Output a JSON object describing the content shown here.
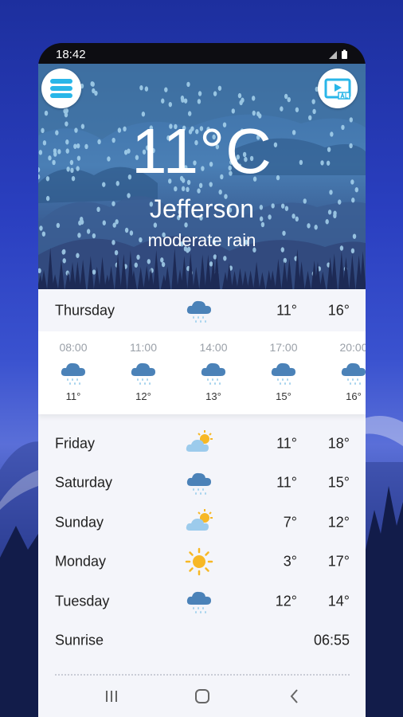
{
  "status_bar": {
    "time": "18:42"
  },
  "current": {
    "temperature": "11°C",
    "city": "Jefferson",
    "condition": "moderate rain"
  },
  "today": {
    "day": "Thursday",
    "icon": "rain-cloud-icon",
    "low": "11°",
    "high": "16°",
    "hourly": [
      {
        "time": "08:00",
        "icon": "rain-cloud-icon",
        "temp": "11°"
      },
      {
        "time": "11:00",
        "icon": "rain-cloud-icon",
        "temp": "12°"
      },
      {
        "time": "14:00",
        "icon": "rain-cloud-icon",
        "temp": "13°"
      },
      {
        "time": "17:00",
        "icon": "rain-cloud-icon",
        "temp": "15°"
      },
      {
        "time": "20:00",
        "icon": "rain-cloud-icon",
        "temp": "16°"
      }
    ]
  },
  "forecast": [
    {
      "day": "Friday",
      "icon": "partly-sunny-icon",
      "low": "11°",
      "high": "18°"
    },
    {
      "day": "Saturday",
      "icon": "rain-cloud-icon",
      "low": "11°",
      "high": "15°"
    },
    {
      "day": "Sunday",
      "icon": "partly-sunny-icon",
      "low": "7°",
      "high": "12°"
    },
    {
      "day": "Monday",
      "icon": "sun-icon",
      "low": "3°",
      "high": "17°"
    },
    {
      "day": "Tuesday",
      "icon": "rain-cloud-icon",
      "low": "12°",
      "high": "14°"
    }
  ],
  "sunrise": {
    "label": "Sunrise",
    "time": "06:55"
  },
  "colors": {
    "background_top": "#1d2f9e",
    "hero_sky": "#4a7fb5",
    "rain_drop": "#a8d4ee",
    "cloud_icon": "#4b82b8",
    "sun_icon": "#f7b825",
    "accent_icon": "#29b6e8"
  }
}
